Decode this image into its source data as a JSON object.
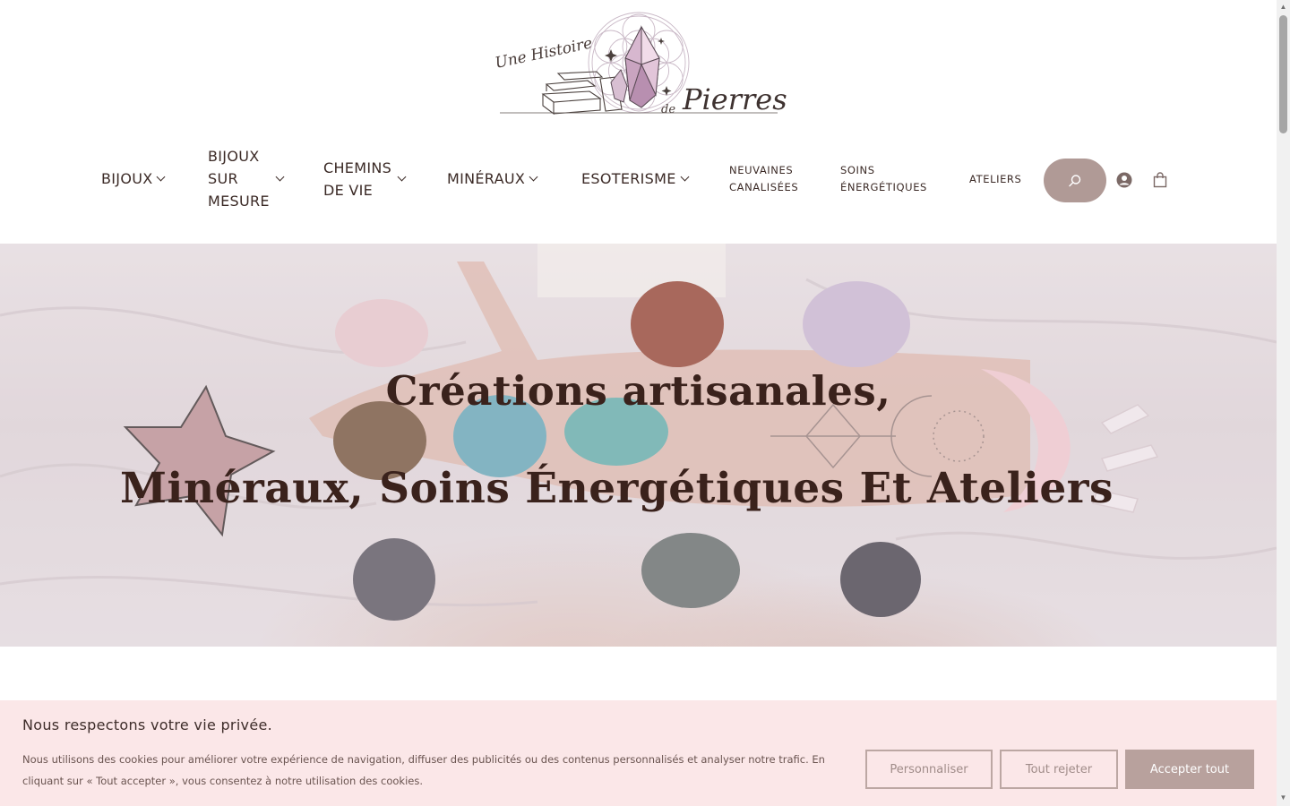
{
  "logo": {
    "line1": "Une Histoire",
    "line2": "de",
    "line3": "Pierres"
  },
  "nav": {
    "items": [
      {
        "label": "BIJOUX",
        "has_dropdown": true
      },
      {
        "label_lines": [
          "BIJOUX",
          "SUR",
          "MESURE"
        ],
        "has_dropdown": true
      },
      {
        "label_lines": [
          "CHEMINS",
          "DE VIE"
        ],
        "has_dropdown": true
      },
      {
        "label": "MINÉRAUX",
        "has_dropdown": true
      },
      {
        "label": "ESOTERISME",
        "has_dropdown": true
      },
      {
        "label_lines": [
          "NEUVAINES",
          "CANALISÉES"
        ],
        "has_dropdown": false
      },
      {
        "label_lines": [
          "SOINS",
          "ÉNERGÉTIQUES"
        ],
        "has_dropdown": false
      },
      {
        "label": "ATELIERS",
        "has_dropdown": false
      }
    ],
    "icons": [
      "search-icon",
      "account-icon",
      "cart-icon"
    ]
  },
  "hero": {
    "title_line1": "Créations artisanales,",
    "title_line2": "Minéraux, Soins Énergétiques Et Ateliers"
  },
  "cookie": {
    "title": "Nous respectons votre vie privée.",
    "text": "Nous utilisons des cookies pour améliorer votre expérience de navigation, diffuser des publicités ou des contenus personnalisés et analyser notre trafic. En cliquant sur « Tout accepter », vous consentez à notre utilisation des cookies.",
    "buttons": {
      "customize": "Personnaliser",
      "reject": "Tout rejeter",
      "accept": "Accepter tout"
    }
  },
  "colors": {
    "accent": "#b09a96",
    "text": "#3b2a26",
    "cookie_bg": "#fbe7e8"
  }
}
